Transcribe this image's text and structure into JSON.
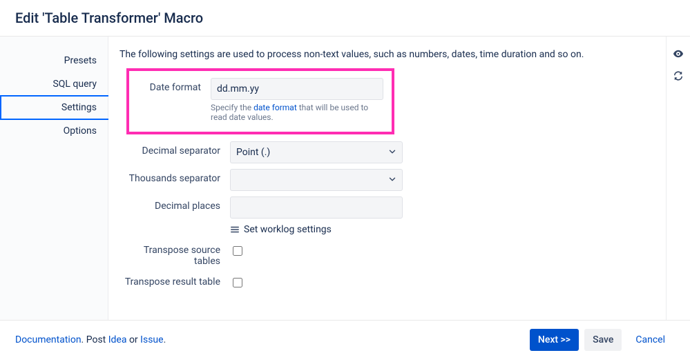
{
  "header": {
    "title": "Edit 'Table Transformer' Macro"
  },
  "sidebar": {
    "tabs": [
      "Presets",
      "SQL query",
      "Settings",
      "Options"
    ]
  },
  "intro": "The following settings are used to process non-text values, such as numbers, dates, time duration and so on.",
  "form": {
    "date_format": {
      "label": "Date format",
      "value": "dd.mm.yy",
      "hint_before": "Specify the ",
      "hint_link": "date format",
      "hint_after": " that will be used to read date values."
    },
    "decimal_separator": {
      "label": "Decimal separator",
      "value": "Point (.)"
    },
    "thousands_separator": {
      "label": "Thousands separator",
      "value": ""
    },
    "decimal_places": {
      "label": "Decimal places",
      "value": ""
    },
    "worklog": {
      "label": "Set worklog settings"
    },
    "transpose_source": {
      "label": "Transpose source tables"
    },
    "transpose_result": {
      "label": "Transpose result table"
    }
  },
  "footer": {
    "doc": "Documentation",
    "post_before": ". Post ",
    "idea": "Idea",
    "or": " or ",
    "issue": "Issue",
    "period": ".",
    "next": "Next >>",
    "save": "Save",
    "cancel": "Cancel"
  }
}
